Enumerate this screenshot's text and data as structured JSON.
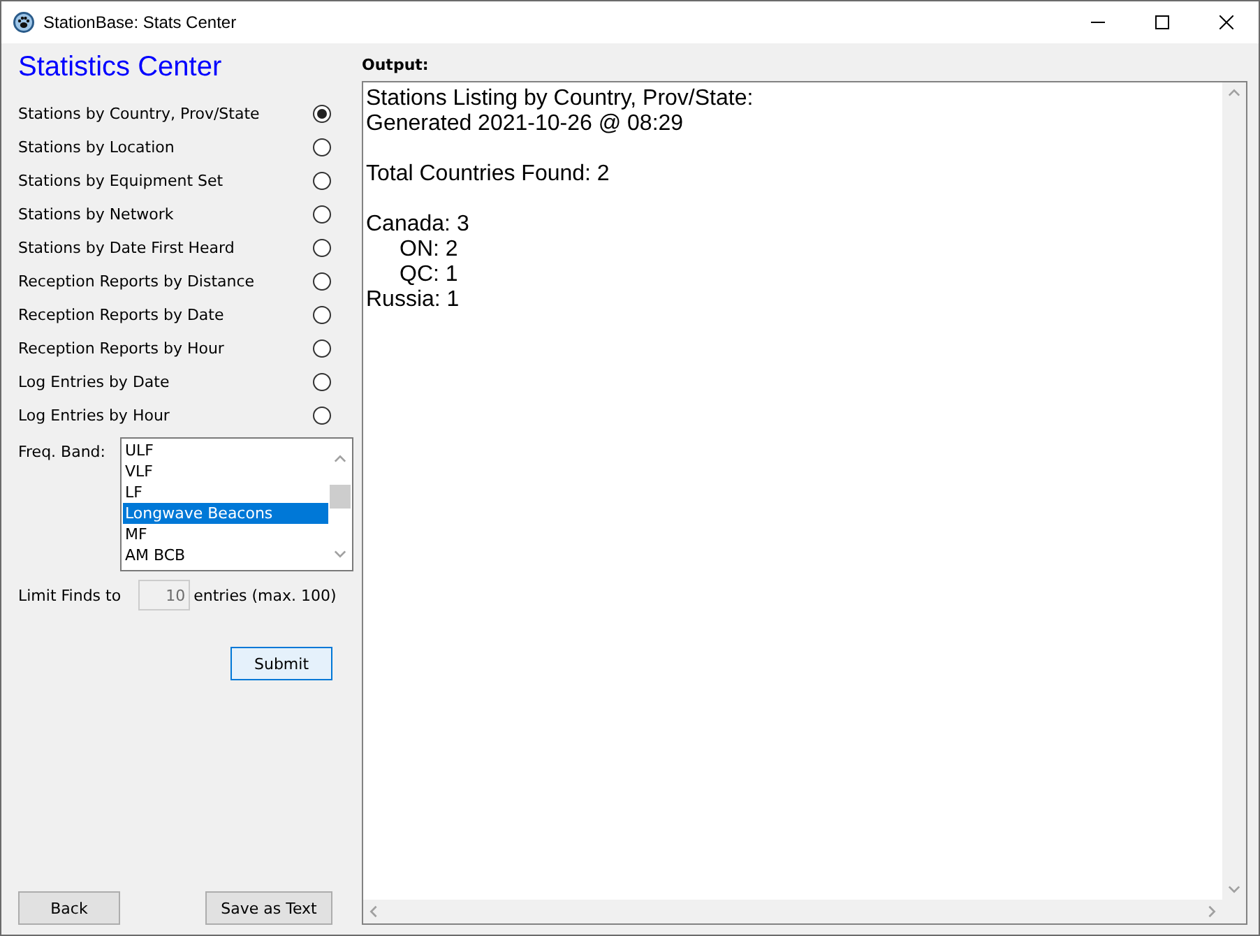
{
  "window": {
    "title": "StationBase: Stats Center"
  },
  "heading": "Statistics Center",
  "reports": [
    {
      "label": "Stations by Country, Prov/State",
      "selected": true
    },
    {
      "label": "Stations by Location",
      "selected": false
    },
    {
      "label": "Stations by Equipment Set",
      "selected": false
    },
    {
      "label": "Stations by Network",
      "selected": false
    },
    {
      "label": "Stations by Date First Heard",
      "selected": false
    },
    {
      "label": "Reception Reports by Distance",
      "selected": false
    },
    {
      "label": "Reception Reports by Date",
      "selected": false
    },
    {
      "label": "Reception Reports by Hour",
      "selected": false
    },
    {
      "label": "Log Entries by Date",
      "selected": false
    },
    {
      "label": "Log Entries by Hour",
      "selected": false
    }
  ],
  "freq_band": {
    "label": "Freq. Band:",
    "items": [
      {
        "label": "ULF",
        "selected": false
      },
      {
        "label": "VLF",
        "selected": false
      },
      {
        "label": "LF",
        "selected": false
      },
      {
        "label": "Longwave Beacons",
        "selected": true
      },
      {
        "label": "MF",
        "selected": false
      },
      {
        "label": "AM BCB",
        "selected": false
      }
    ]
  },
  "limit": {
    "prefix": "Limit Finds to",
    "value": "10",
    "suffix": "entries (max. 100)"
  },
  "submit": "Submit",
  "bottom_buttons": [
    "Back",
    "Save as Text"
  ],
  "output": {
    "label": "Output:",
    "paragraphs": [
      {
        "lines": [
          {
            "text": "Stations Listing by Country, Prov/State:"
          },
          {
            "text": "Generated 2021-10-26 @ 08:29"
          }
        ]
      },
      {
        "lines": [
          {
            "text": "Total Countries Found: 2"
          }
        ]
      },
      {
        "lines": [
          {
            "text": "Canada: 3",
            "children": [
              {
                "text": "ON: 2"
              },
              {
                "text": "QC: 1"
              }
            ]
          },
          {
            "text": "Russia: 1"
          }
        ]
      }
    ]
  }
}
